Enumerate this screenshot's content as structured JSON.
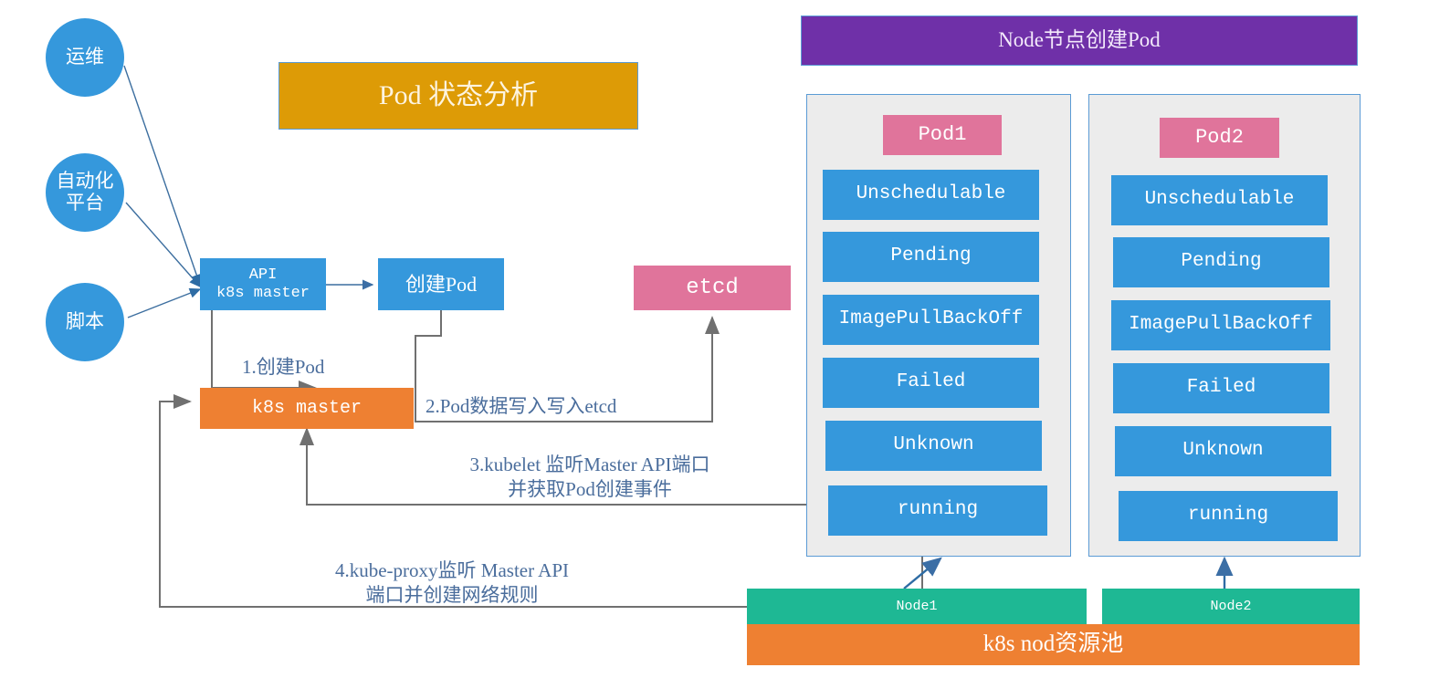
{
  "title_box": {
    "label": "Pod  状态分析"
  },
  "actors": [
    {
      "name": "ops",
      "label": "运维"
    },
    {
      "name": "automation-platform",
      "label": "自动化\n平台"
    },
    {
      "name": "script",
      "label": "脚本"
    }
  ],
  "flow": {
    "api_master": {
      "line1": "API",
      "line2": "k8s master"
    },
    "create_pod": {
      "label": "创建Pod"
    },
    "etcd": {
      "label": "etcd"
    },
    "k8s_master": {
      "label": "k8s master"
    }
  },
  "steps": [
    {
      "id": "step1",
      "label": "1.创建Pod"
    },
    {
      "id": "step2",
      "label": "2.Pod数据写入写入etcd"
    },
    {
      "id": "step3",
      "label": "3.kubelet 监听Master API端口\n并获取Pod创建事件"
    },
    {
      "id": "step4",
      "label": "4.kube-proxy监听 Master API\n端口并创建网络规则"
    }
  ],
  "right_panel": {
    "header": "Node节点创建Pod",
    "pods": [
      {
        "name": "Pod1",
        "states": [
          "Unschedulable",
          "Pending",
          "ImagePullBackOff",
          "Failed",
          "Unknown",
          "running"
        ]
      },
      {
        "name": "Pod2",
        "states": [
          "Unschedulable",
          "Pending",
          "ImagePullBackOff",
          "Failed",
          "Unknown",
          "running"
        ]
      }
    ],
    "nodes": [
      {
        "label": "Node1"
      },
      {
        "label": "Node2"
      }
    ],
    "resource_pool": {
      "label": "k8s nod资源池"
    }
  },
  "colors": {
    "blue": "#3598dc",
    "orange": "#ee8032",
    "pink": "#e0749b",
    "gold": "#dd9b06",
    "purple": "#6f30a8",
    "green": "#1eb894",
    "panel_bg": "#ececec",
    "panel_border": "#5b9bd5",
    "wire_gray": "#707070",
    "wire_blue": "#4a7ebb",
    "label_text": "#4a6d9c"
  }
}
